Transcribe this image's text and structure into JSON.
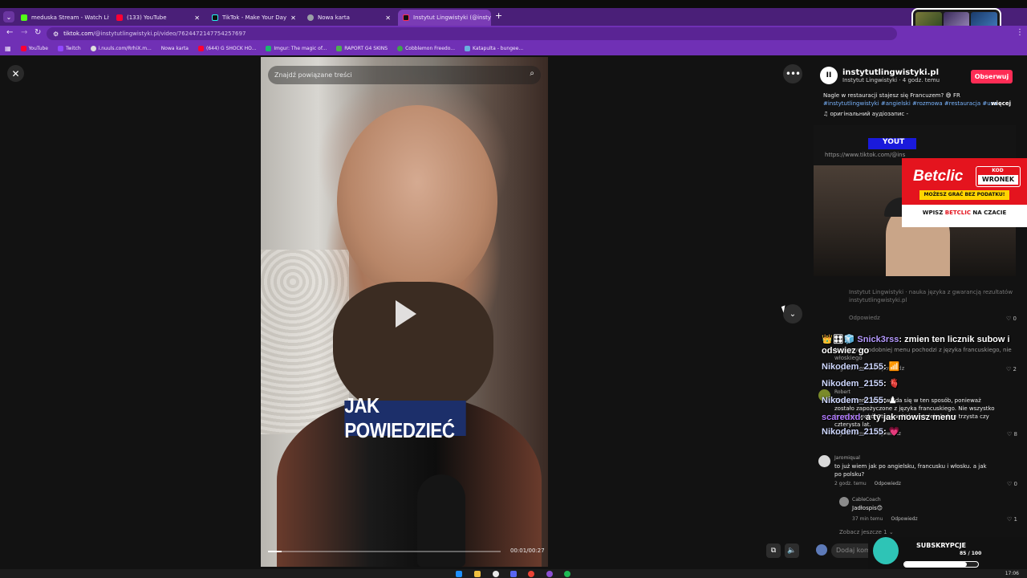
{
  "browser": {
    "tabs": [
      {
        "title": "meduska Stream - Watch Live o",
        "color": "#53fc18",
        "active": false
      },
      {
        "title": "(133) YouTube",
        "color": "#ff0033",
        "active": false
      },
      {
        "title": "TikTok - Make Your Day",
        "color": "#111111",
        "active": false
      },
      {
        "title": "Nowa karta",
        "color": "#9aa0a6",
        "active": false
      },
      {
        "title": "Instytut Lingwistyki (@insty",
        "color": "#111111",
        "active": true
      }
    ],
    "tab_close": "✕",
    "new_tab": "+",
    "url_main": "tiktok.com",
    "url_rest": "/@instytutlingwistyki.pl/video/7624472147754257697",
    "bookmarks": [
      {
        "label": "YouTube",
        "color": "#ff0033"
      },
      {
        "label": "Twitch",
        "color": "#9146ff"
      },
      {
        "label": "i.nuuls.com/RrhiX.m...",
        "color": "#dddddd"
      },
      {
        "label": "Nowa karta",
        "color": "#9aa0a6"
      },
      {
        "label": "(644) G SHOCK HO...",
        "color": "#ff0033"
      },
      {
        "label": "Imgur: The magic of...",
        "color": "#1bb76e"
      },
      {
        "label": "RAPORT G4 SKINS",
        "color": "#4caf50"
      },
      {
        "label": "Cobblemon Freedo...",
        "color": "#3fa34d"
      },
      {
        "label": "Katapulta - bungee...",
        "color": "#6ab0de"
      }
    ]
  },
  "video": {
    "search_placeholder": "Znajdź powiązane treści",
    "caption": "JAK POWIEDZIEĆ",
    "time": "00:01/00:27",
    "progress": 0.06
  },
  "author": {
    "handle": "instytutlingwistyki.pl",
    "subtitle": "Instytut Lingwistyki · 4 godz. temu",
    "follow_label": "Obserwuj",
    "description": "Nagle w restauracji stajesz się Francuzem? 😅 FR",
    "tags": "#instytutlingwistyki #angielski #rozmowa #restauracja #usa",
    "more_label": "więcej",
    "audio": "♫ оригінальний аудіозапис -"
  },
  "stream": {
    "yt_label": "YOUT",
    "url_hint": "https://www.tiktok.com/@ins"
  },
  "ad": {
    "brand": "Betclic",
    "kod_label": "KOD",
    "kod_value": "WRONEK",
    "tax_label": "MOŻESZ GRAĆ BEZ PODATKU!",
    "promo_prefix": "WPISZ",
    "promo_brand": "BETCLIC",
    "promo_suffix": "NA CZACIE"
  },
  "chat": [
    {
      "badges": "👑🎛🧊",
      "user": "Snick3rss",
      "message": "zmien ten licznik subow i odswiez go"
    },
    {
      "badges": "",
      "user": "Nikodem_2155",
      "message": "📶"
    },
    {
      "badges": "",
      "user": "Nikodem_2155",
      "message": "🫀"
    },
    {
      "badges": "",
      "user": "Nikodem_2155",
      "message": "♟"
    },
    {
      "badges": "",
      "user": "scaredxd",
      "message": "a ty jak mowisz menu"
    },
    {
      "badges": "",
      "user": "Nikodem_2155",
      "message": "💗"
    }
  ],
  "faded_text": {
    "line1": "Instytut Lingwistyki · nauka języka z gwarancją rezultatów",
    "line2": "instytutlingwistyki.pl",
    "line3": "Odpowiedz",
    "line4": "Najprawdopodobniej menu pochodzi z języka francuskiego, nie",
    "line5": "włoskiego",
    "line6": "2 godz. temu   Odpowiedz",
    "likes_a": "♡ 0",
    "likes_b": "♡ 2"
  },
  "comments": [
    {
      "name": "Robert",
      "text": "Słowo menu wypowiada się w ten sposób, ponieważ zostało zapożyczone z języka francuskiego. Nie wszystko kręci się wokół Stanów, które istnieją ledwo trzysta czy czterysta lat.",
      "time": "4 godz. temu",
      "reply": "Odpowiedz",
      "likes": "♡ 8"
    },
    {
      "name": "Jaromiqual",
      "text": "to już wiem jak po angielsku, francusku i włosku. a jak po polsku?",
      "time": "2 godz. temu",
      "reply": "Odpowiedz",
      "likes": "♡ 0"
    },
    {
      "name": "CableCoach",
      "text": "Jadłospis😊",
      "time": "37 min temu",
      "reply": "Odpowiedz",
      "likes": "♡ 1"
    }
  ],
  "see_more": "Zobacz jeszcze 1 ⌄",
  "comment_placeholder": "Dodaj kom",
  "subs": {
    "label": "SUBSKRYPCJE",
    "count": "85 / 100",
    "progress": 0.85
  },
  "taskbar": {
    "clock": "17:06"
  }
}
